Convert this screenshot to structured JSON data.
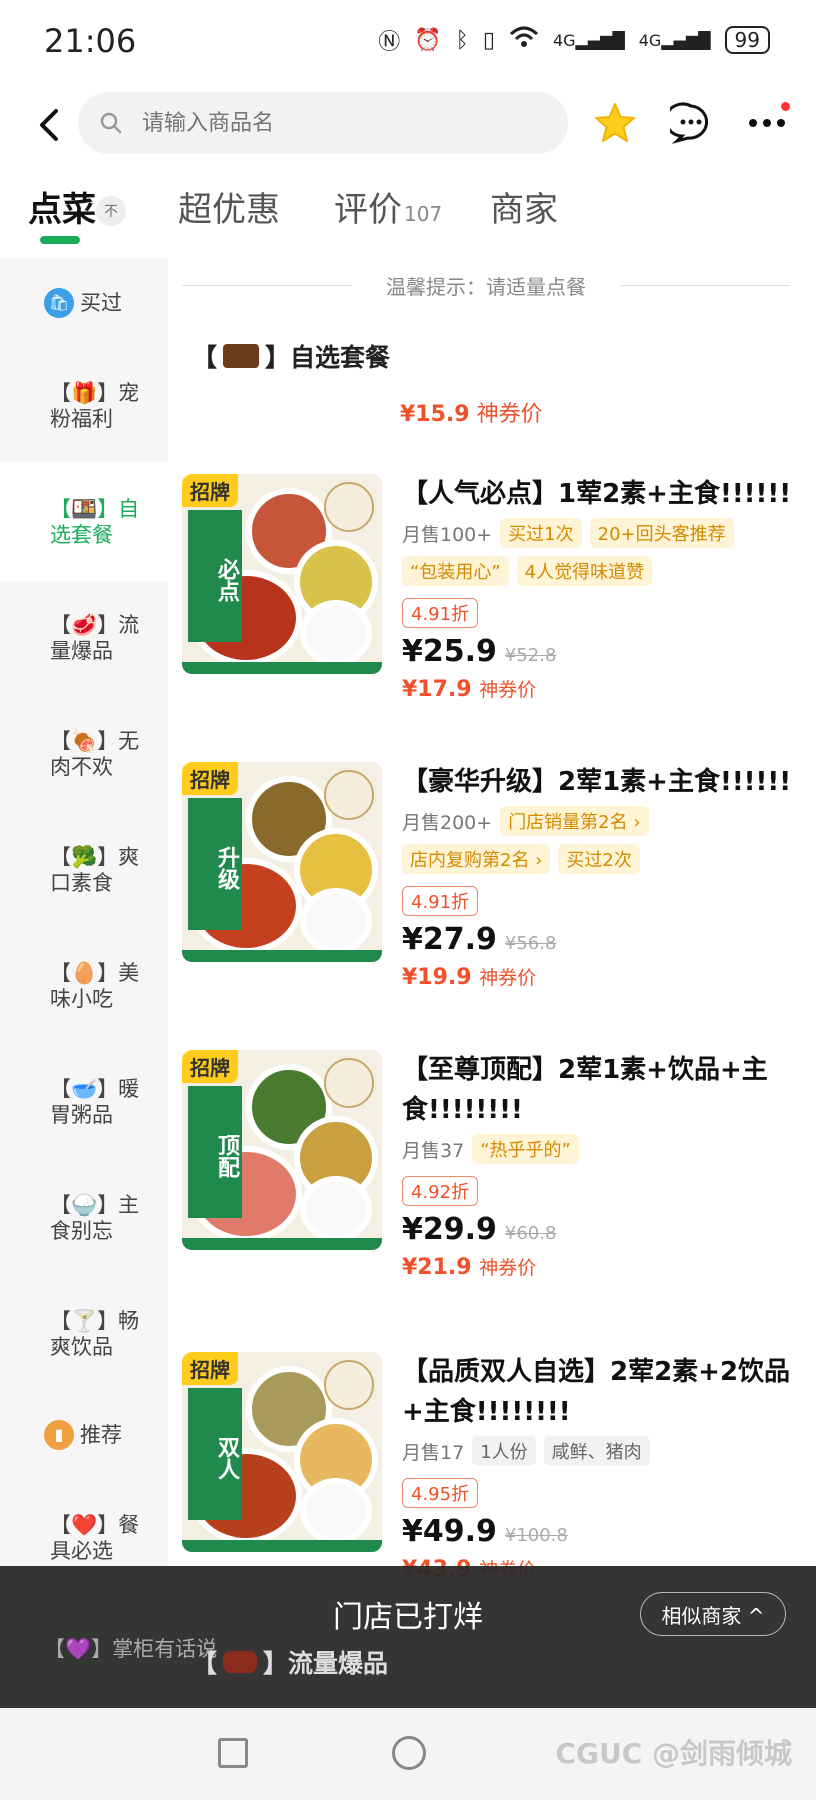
{
  "status": {
    "time": "21:06",
    "battery": "99",
    "network": "4G"
  },
  "search": {
    "placeholder": "请输入商品名"
  },
  "tabs": [
    {
      "label": "点菜",
      "active": true
    },
    {
      "label": "超优惠"
    },
    {
      "label": "评价",
      "count": "107"
    },
    {
      "label": "商家"
    }
  ],
  "tabs_collapse": "不",
  "sidebar": {
    "items": [
      {
        "label": "买过"
      },
      {
        "label": "【🎁】宠粉福利"
      },
      {
        "label": "【🍱】自选套餐"
      },
      {
        "label": "【🥩】流量爆品"
      },
      {
        "label": "【🍖】无肉不欢"
      },
      {
        "label": "【🥦】爽口素食"
      },
      {
        "label": "【🥚】美味小吃"
      },
      {
        "label": "【🥣】暖胃粥品"
      },
      {
        "label": "【🍚】主食别忘"
      },
      {
        "label": "【🍸】畅爽饮品"
      },
      {
        "label": "推荐"
      },
      {
        "label": "【❤️】餐具必选"
      },
      {
        "label": "【💜】掌柜有话说"
      }
    ]
  },
  "notice": "温馨提示：请适量点餐",
  "section": {
    "title": "自选套餐",
    "bracket_open": "【",
    "bracket_close": "】",
    "promo_price": "¥15.9",
    "promo_label": "神券价"
  },
  "products": [
    {
      "badge": "招牌",
      "img_text": "必点",
      "name": "【人气必点】1荤2素+主食!!!!!!",
      "sales": "月售100+",
      "tags": [
        "买过1次",
        "20+回头客推荐",
        "“包装用心”",
        "4人觉得味道赞"
      ],
      "discount": "4.91折",
      "price": "¥25.9",
      "original_price": "¥52.8",
      "promo_price": "¥17.9",
      "promo_label": "神券价"
    },
    {
      "badge": "招牌",
      "img_text": "升级",
      "name": "【豪华升级】2荤1素+主食!!!!!!",
      "sales": "月售200+",
      "tags": [
        "门店销量第2名 ›",
        "店内复购第2名 ›",
        "买过2次"
      ],
      "discount": "4.91折",
      "price": "¥27.9",
      "original_price": "¥56.8",
      "promo_price": "¥19.9",
      "promo_label": "神券价"
    },
    {
      "badge": "招牌",
      "img_text": "顶配",
      "name": "【至尊顶配】2荤1素+饮品+主食!!!!!!!!",
      "sales": "月售37",
      "tags": [
        "“热乎乎的”"
      ],
      "discount": "4.92折",
      "price": "¥29.9",
      "original_price": "¥60.8",
      "promo_price": "¥21.9",
      "promo_label": "神券价"
    },
    {
      "badge": "招牌",
      "img_text": "双人",
      "name": "【品质双人自选】2荤2素+2饮品+主食!!!!!!!!",
      "sales": "月售17",
      "tags": [
        "1人份",
        "咸鲜、猪肉"
      ],
      "discount": "4.95折",
      "price": "¥49.9",
      "original_price": "¥100.8",
      "promo_price": "¥43.9",
      "promo_label": "神券价"
    }
  ],
  "closed_banner": {
    "text": "门店已打烊",
    "similar_button": "相似商家 ^",
    "next_section": "流量爆品"
  },
  "watermark": "CGUC @剑雨倾城",
  "colors": {
    "accent_green": "#1aad5a",
    "price_red": "#f0502a",
    "tag_orange": "#d58a00",
    "badge_yellow": "#ffcc1a"
  }
}
